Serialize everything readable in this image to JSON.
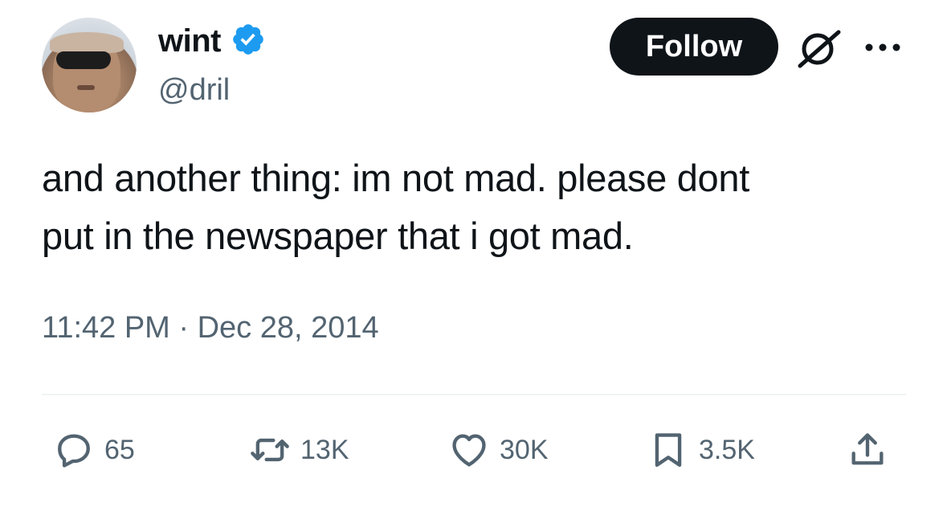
{
  "author": {
    "display_name": "wint",
    "handle": "@dril",
    "verified": true
  },
  "actions_top": {
    "follow_label": "Follow"
  },
  "tweet": {
    "text": "and another thing: im not mad. please dont\nput in the newspaper that i got mad.",
    "timestamp": "11:42 PM · Dec 28, 2014"
  },
  "stats": {
    "replies": "65",
    "retweets": "13K",
    "likes": "30K",
    "bookmarks": "3.5K"
  },
  "icons": {
    "verified": "verified-badge-icon",
    "grok": "grok-icon",
    "more": "more-options-icon",
    "reply": "reply-icon",
    "retweet": "retweet-icon",
    "like": "heart-icon",
    "bookmark": "bookmark-icon",
    "share": "share-icon"
  },
  "colors": {
    "text": "#0f1419",
    "secondary": "#536471",
    "verified_blue": "#1d9bf0",
    "follow_bg": "#0f1419",
    "divider": "#eff3f4"
  }
}
